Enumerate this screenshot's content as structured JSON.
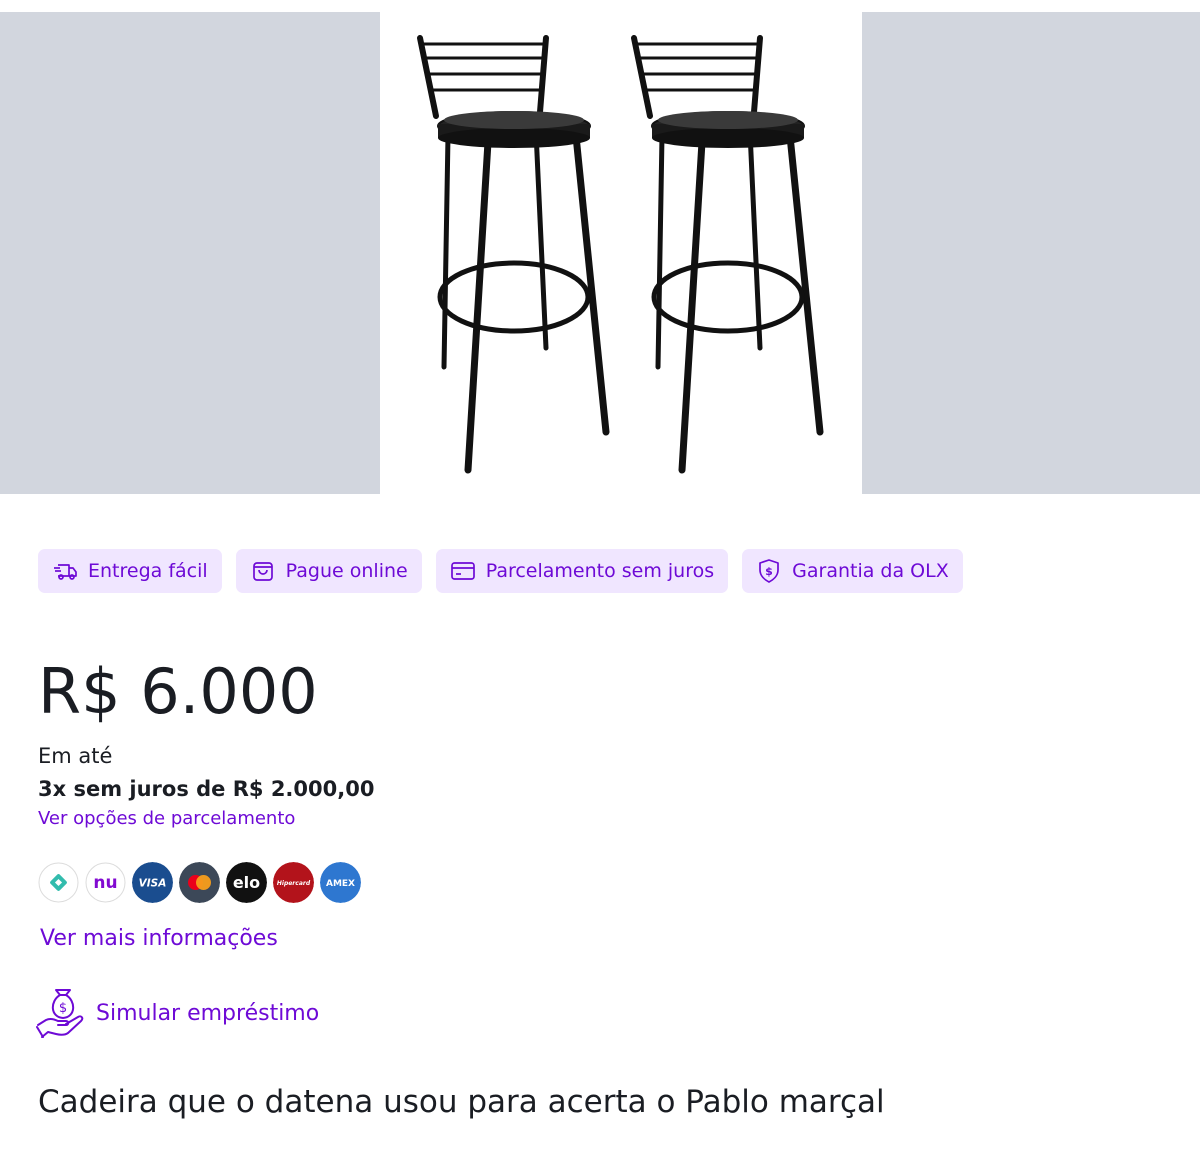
{
  "badges": [
    {
      "label": "Entrega fácil",
      "icon": "truck-fast-icon"
    },
    {
      "label": "Pague online",
      "icon": "shopping-bag-icon"
    },
    {
      "label": "Parcelamento sem juros",
      "icon": "credit-card-icon"
    },
    {
      "label": "Garantia da OLX",
      "icon": "shield-dollar-icon"
    }
  ],
  "price": "R$ 6.000",
  "installments": {
    "prefix": "Em até",
    "detail": "3x sem juros de R$ 2.000,00",
    "link": "Ver opções de parcelamento"
  },
  "payment_methods": [
    {
      "name": "pix",
      "icon": "pix-icon"
    },
    {
      "name": "nubank",
      "label": "nu",
      "icon": "nubank-icon"
    },
    {
      "name": "visa",
      "label": "VISA",
      "icon": "visa-icon"
    },
    {
      "name": "mastercard",
      "icon": "mastercard-icon"
    },
    {
      "name": "elo",
      "label": "elo",
      "icon": "elo-icon"
    },
    {
      "name": "hipercard",
      "label": "Hipercard",
      "icon": "hipercard-icon"
    },
    {
      "name": "amex",
      "label": "AMEX",
      "icon": "amex-icon"
    }
  ],
  "more_info_link": "Ver mais informações",
  "loan_link": "Simular empréstimo",
  "listing_title": "Cadeira que o datena usou para acerta o Pablo marçal",
  "colors": {
    "accent": "#6e0ad6",
    "badge_bg": "#f0e6ff",
    "gallery_bg": "#d2d6de",
    "text": "#1a1d23"
  }
}
